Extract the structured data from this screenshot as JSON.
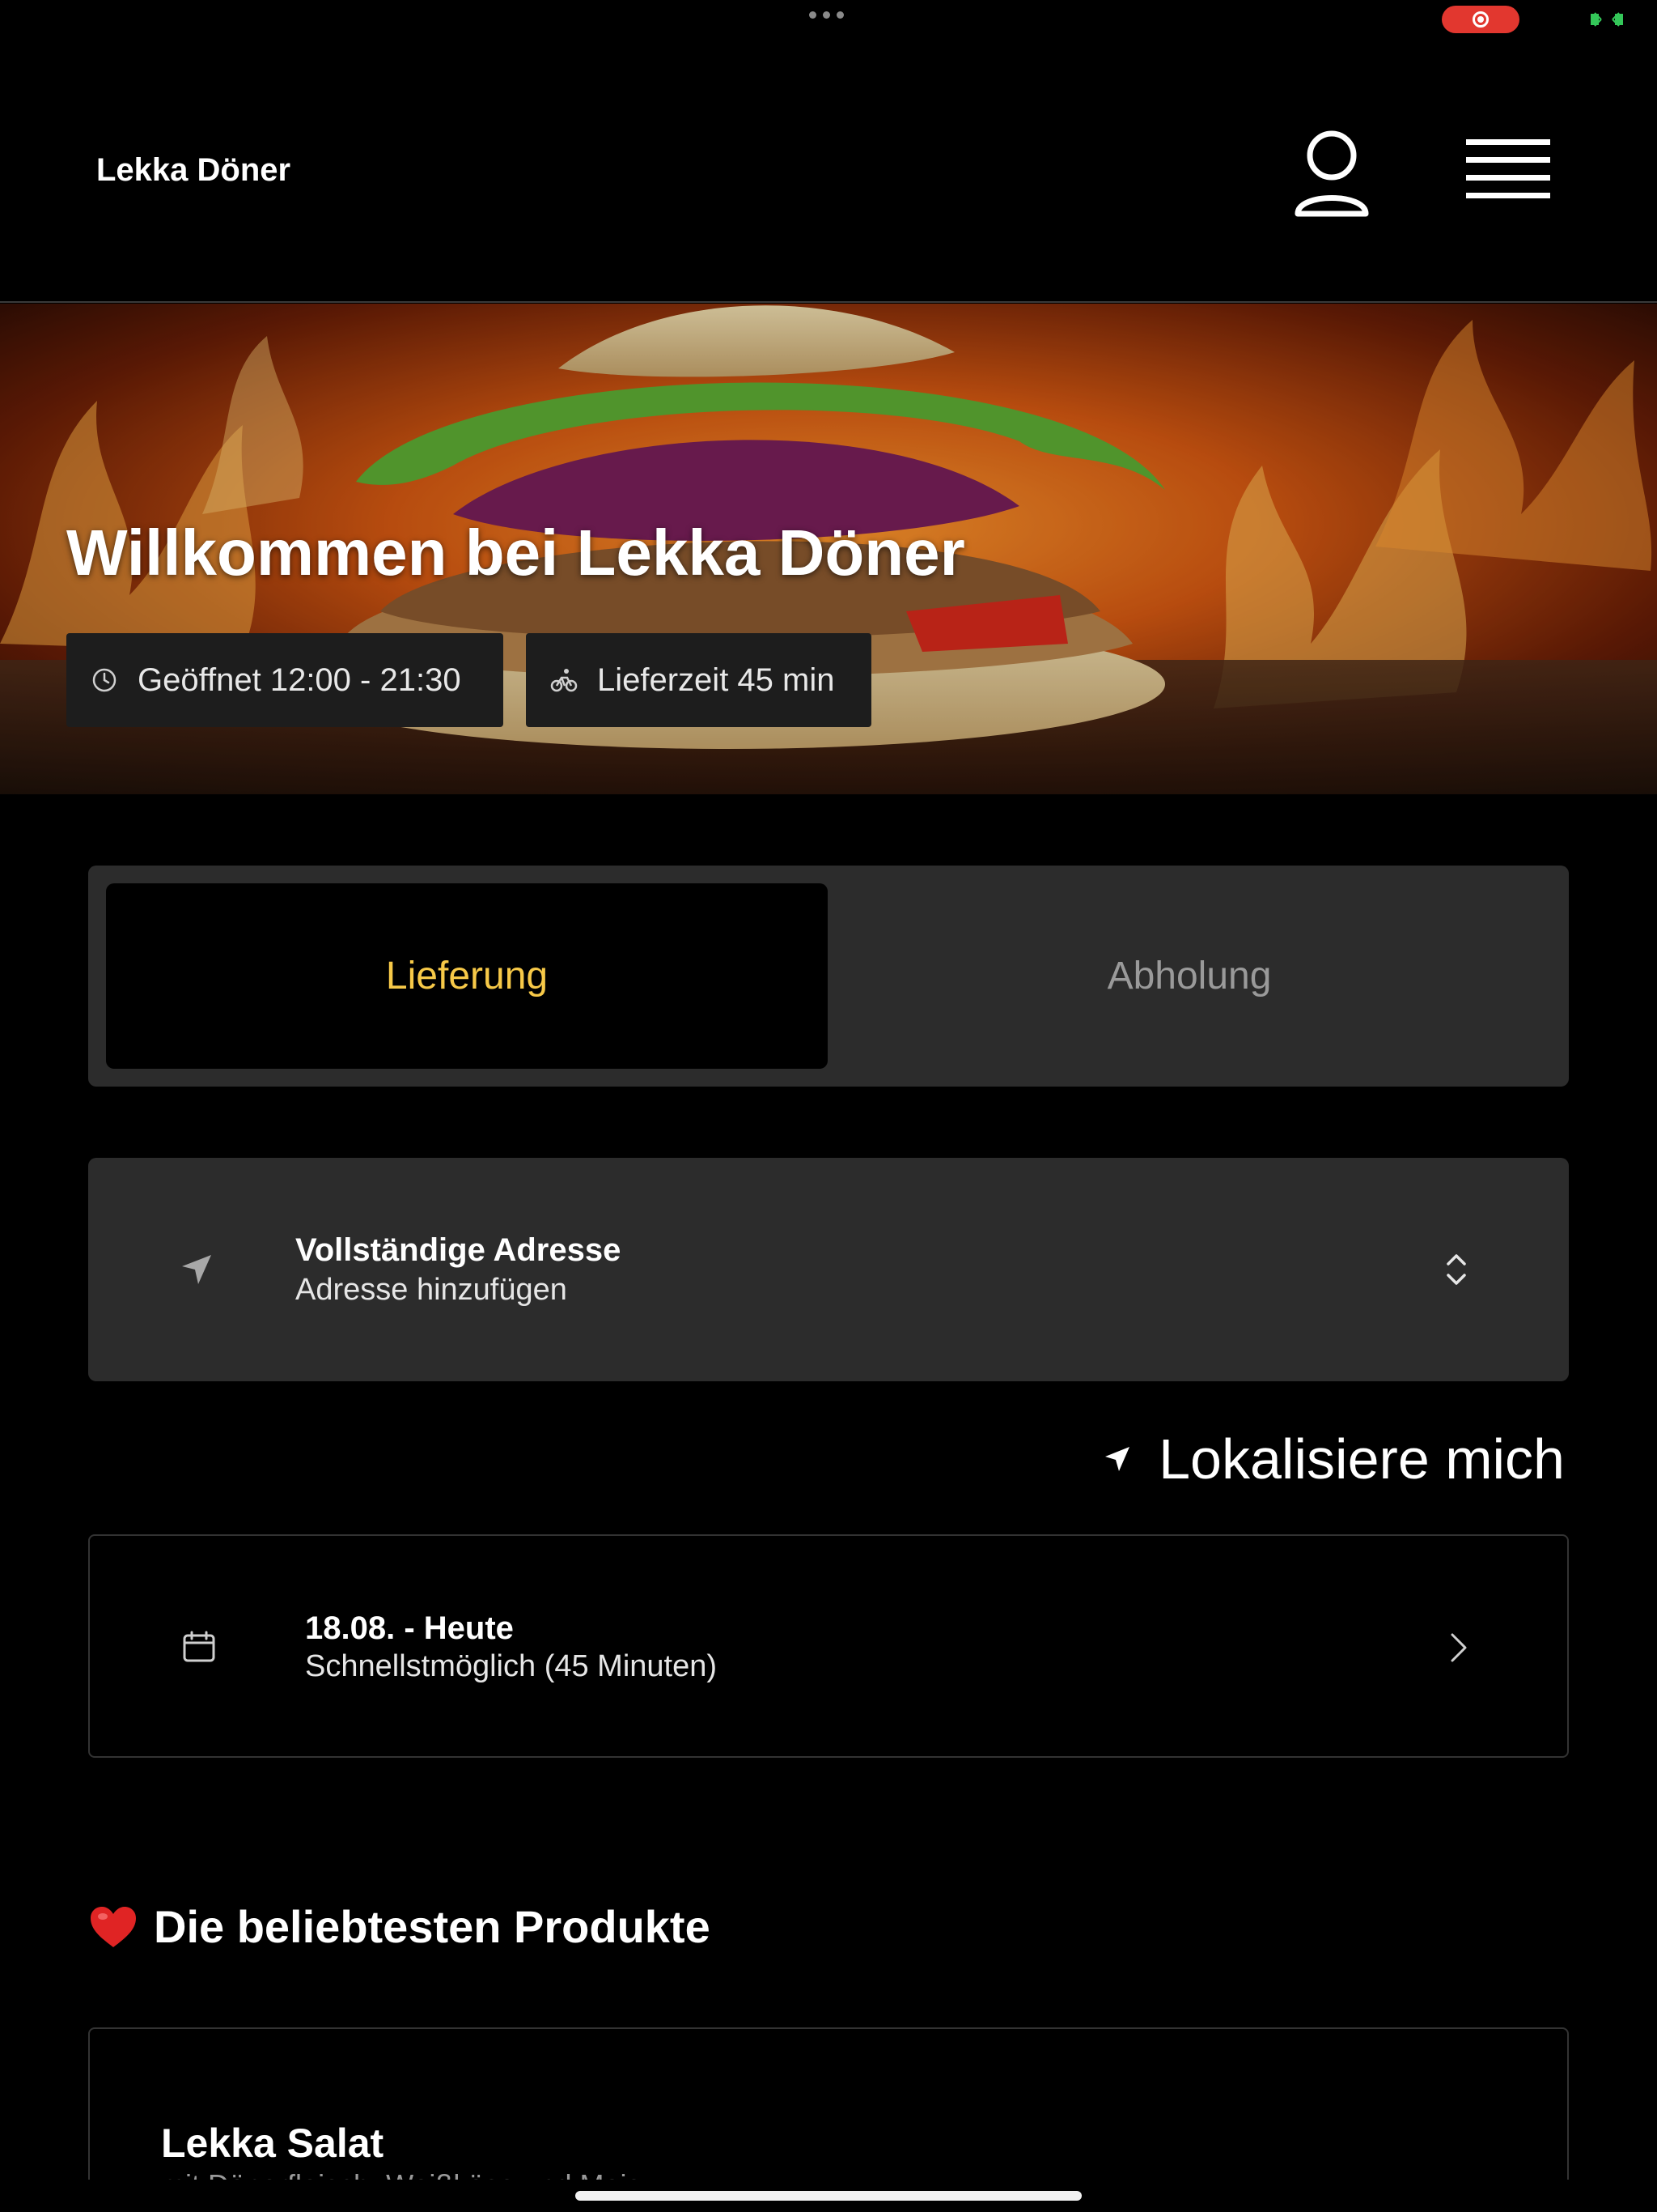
{
  "app": {
    "title": "Lekka Döner"
  },
  "hero": {
    "title": "Willkommen bei Lekka Döner",
    "hours_label": "Geöffnet 12:00 - 21:30",
    "delivery_label": "Lieferzeit 45 min"
  },
  "mode_toggle": {
    "active_label": "Lieferung",
    "inactive_label": "Abholung",
    "active_color": "#f7c948"
  },
  "address": {
    "title": "Vollständige Adresse",
    "subtitle": "Adresse hinzufügen"
  },
  "locate": {
    "label": "Lokalisiere mich"
  },
  "schedule": {
    "title": "18.08. - Heute",
    "subtitle": "Schnellstmöglich (45 Minuten)"
  },
  "popular": {
    "heading": "Die beliebtesten Produkte",
    "products": [
      {
        "name": "Lekka Salat",
        "description": "mit Dönerfleisch, Weißkäse und Mais"
      }
    ]
  },
  "icons": {
    "user": "user-icon",
    "menu": "hamburger-menu-icon",
    "clock": "clock-icon",
    "bike": "bicycle-icon",
    "navigation": "navigation-arrow-icon",
    "updown": "chevron-up-down-icon",
    "calendar": "calendar-icon",
    "chevron": "chevron-right-icon",
    "heart": "heart-icon"
  }
}
